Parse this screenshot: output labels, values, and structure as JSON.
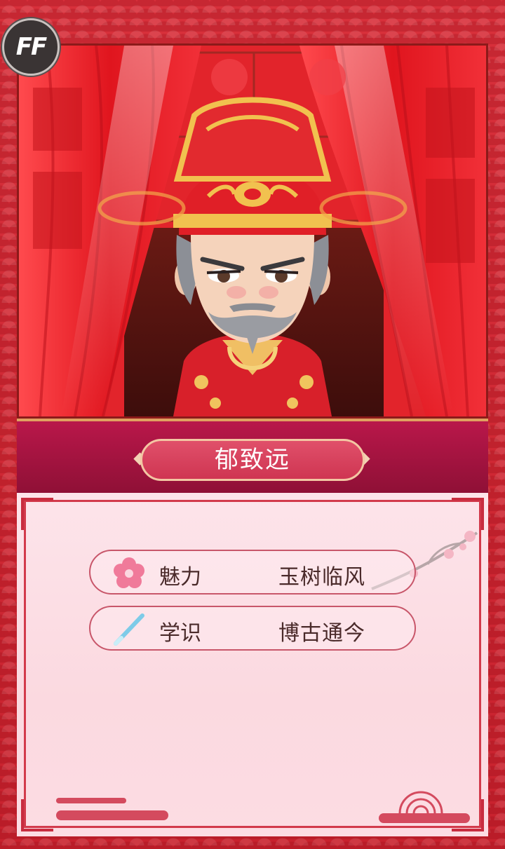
{
  "badge": {
    "label": "FF"
  },
  "character": {
    "name": "郁致远"
  },
  "stats": [
    {
      "icon": "plum-blossom-icon",
      "label": "魅力",
      "value": "玉树临风"
    },
    {
      "icon": "brush-icon",
      "label": "学识",
      "value": "博古通今"
    }
  ],
  "colors": {
    "frame": "#d42a35",
    "name_strip": "#9e1240",
    "card": "#fde4ea",
    "accent": "#c82c3f"
  }
}
